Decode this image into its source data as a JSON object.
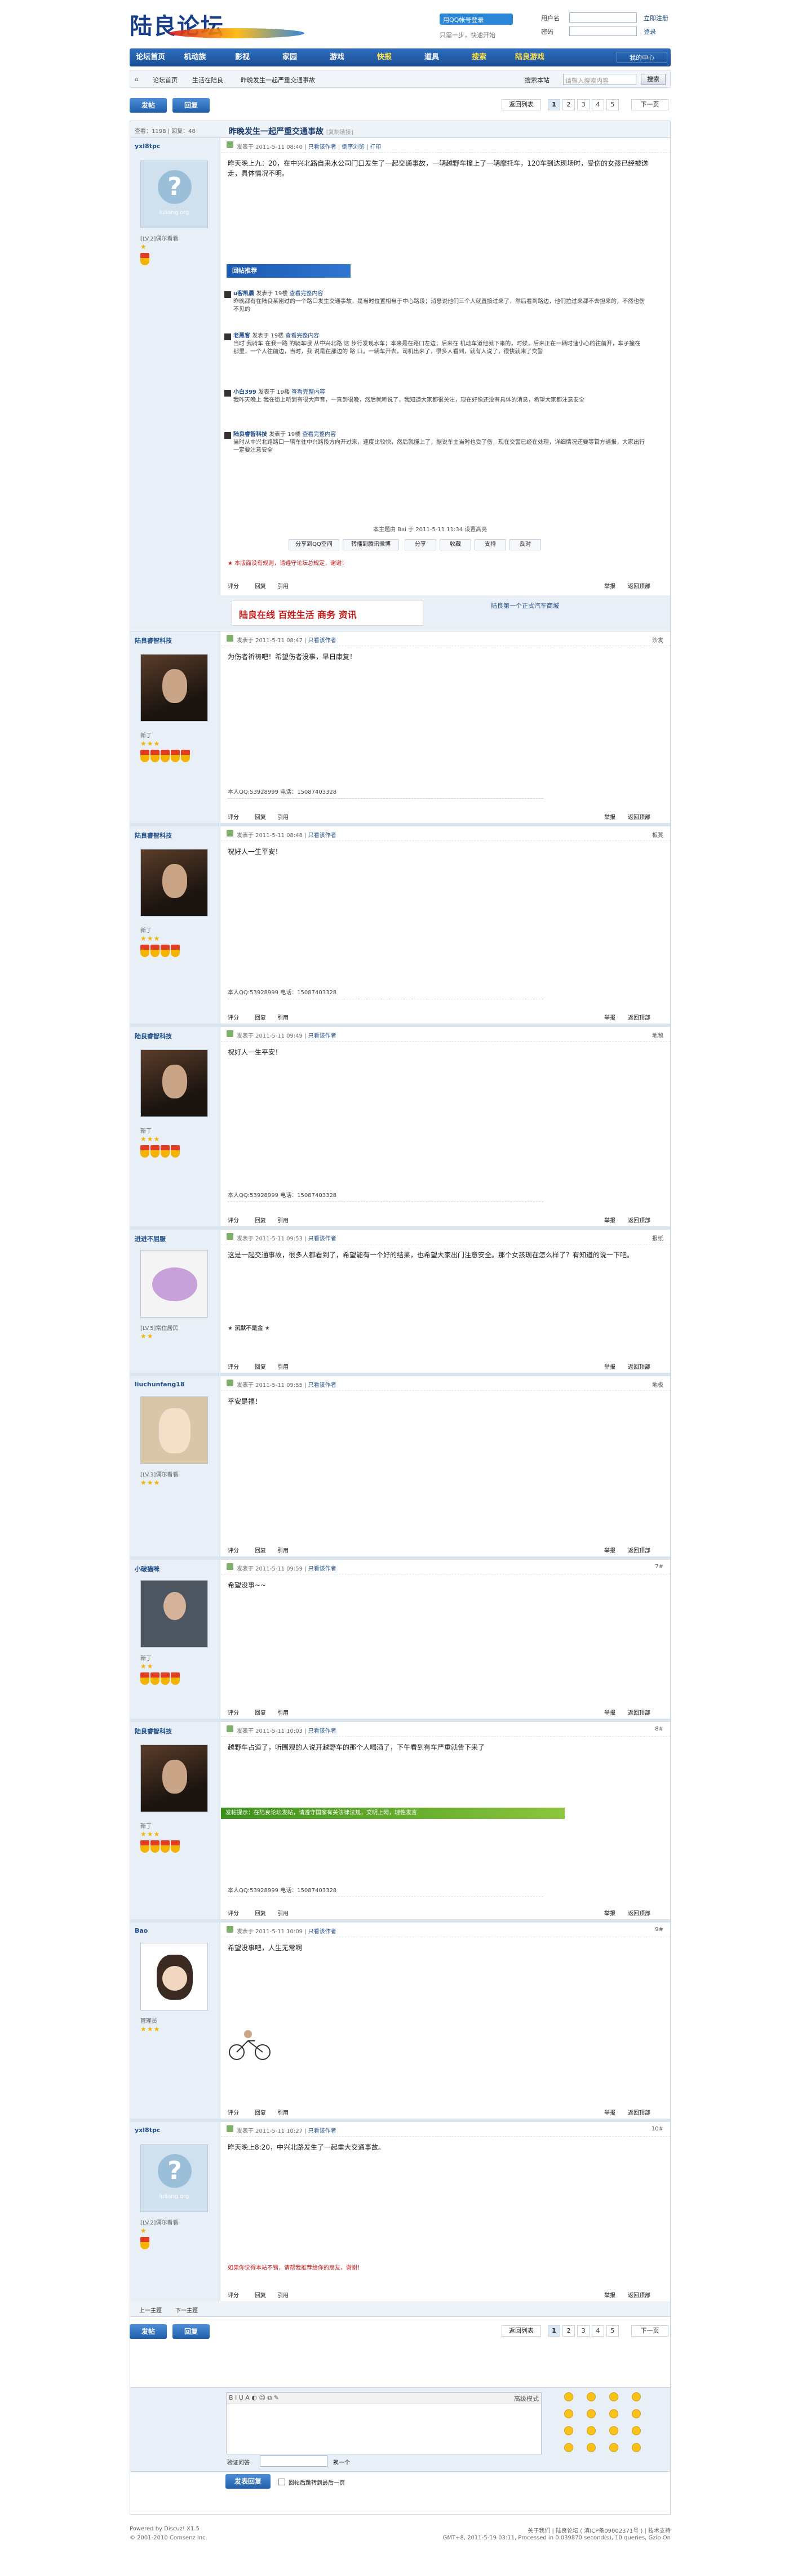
{
  "header": {
    "logo_text": "陆良论坛",
    "qq_login": "用QQ帐号登录",
    "qq_sub": "只需一步，快速开始",
    "username_label": "用户名",
    "password_label": "密码",
    "autologin": "自动登录",
    "register": "立即注册",
    "forgot": "找回密码",
    "login": "登录"
  },
  "nav": {
    "items": [
      "论坛首页",
      "机动族",
      "影视",
      "家园",
      "游戏",
      "快报",
      "道具",
      "搜索",
      "陆良游戏"
    ],
    "my_center": "我的中心"
  },
  "breadcrumb": {
    "items": [
      "论坛首页",
      "生活在陆良",
      "昨晚发生一起严重交通事故"
    ],
    "search_label": "搜索本站",
    "search_placeholder": "请输入搜索内容",
    "search_button": "搜索"
  },
  "actions": {
    "post": "发帖",
    "reply": "回复",
    "pager": {
      "prev": "返回列表",
      "pages": [
        "1",
        "2",
        "3",
        "4",
        "5"
      ],
      "next": "下一页"
    }
  },
  "thread": {
    "stats": "查看：1198 | 回复：48",
    "title": "昨晚发生一起严重交通事故",
    "title_extra": "[复制链接]",
    "rate_header": "回帖推荐",
    "comments": [
      {
        "user": "u客凯晨",
        "time": "发表于 19楼",
        "link": "查看完整内容",
        "text": "昨晚都有在陆良某刚过的一个路口发生交通事故，是当时位置相当于中心路段；消息说他们三个人就直接过来了，然后看到路边，他们拉过来都不去担来的，不然也伤不见的"
      },
      {
        "user": "老黑客",
        "time": "发表于 19楼",
        "link": "查看完整内容",
        "text": "当时 我骑车 在我一路 的骑车哦 从中兴北路 这 步行发现水车；本来是在路口左边；后来在 机动车道他就下来的，时候，后来正在一辆时速小心的往前开，车子撞在那里，一个人往前边，当时，我 说是在那边的 路 口，一辆车开去，司机出来了，很多人看到，就有人说了，很快就来了交警"
      },
      {
        "user": "小白399",
        "time": "发表于 19楼",
        "link": "查看完整内容",
        "text": "我昨天晚上 我在街上听到有很大声音，一直到很晚，然后就听说了，我知道大家都很关注，现在好像还没有具体的消息，希望大家都注意安全"
      },
      {
        "user": "陆良睿智科技",
        "time": "发表于 19楼",
        "link": "查看完整内容",
        "text": "当时从中兴北路路口一辆车往中兴路段方向开过来，速度比较快，然后就撞上了，据说车主当时也受了伤，现在交警已经在处理，详细情况还要等官方通报，大家出行一定要注意安全"
      }
    ],
    "sig_line": "本主题由 Bai 于 2011-5-11 11:34 设置高亮",
    "share": [
      "分享到QQ空间",
      "转播到腾讯微博",
      "分享",
      "收藏",
      "支持",
      "反对"
    ],
    "red_note": "★ 本版面没有规则，请遵守论坛总规定，谢谢！"
  },
  "posts": [
    {
      "user": "yxl8tpc",
      "floor": "楼主",
      "time": "发表于 2011-5-11 08:40",
      "only": "只看该作者",
      "extra": "倒序浏览 | 打印",
      "body": "昨天晚上九：20，在中兴北路自来水公司门口发生了一起交通事故，一辆越野车撞上了一辆摩托车，120车到达现场时，受伤的女孩已经被送走，具体情况不明。",
      "level": "[LV.2]偶尔看看",
      "avatar": "qm"
    },
    {
      "user": "陆良睿智科技",
      "floor": "沙发",
      "time": "发表于 2011-5-11 08:47",
      "only": "只看该作者",
      "body": "为伤者祈祷吧！希望伤者没事，早日康复！",
      "level": "新丁",
      "qq": "本人QQ:53928999  电话：15087403328",
      "avatar": "dark"
    },
    {
      "user": "陆良睿智科技",
      "floor": "板凳",
      "time": "发表于 2011-5-11 08:48",
      "only": "只看该作者",
      "body": "祝好人一生平安！",
      "level": "新丁",
      "qq": "本人QQ:53928999  电话：15087403328",
      "avatar": "dark"
    },
    {
      "user": "陆良睿智科技",
      "floor": "地毯",
      "time": "发表于 2011-5-11 09:49",
      "only": "只看该作者",
      "body": "祝好人一生平安！",
      "level": "新丁",
      "qq": "本人QQ:53928999  电话：15087403328",
      "avatar": "dark"
    },
    {
      "user": "进进不屈服",
      "floor": "报纸",
      "time": "发表于 2011-5-11 09:53",
      "only": "只看该作者",
      "body": "这是一起交通事故，很多人都看到了，希望能有一个好的结果，也希望大家出门注意安全。那个女孩现在怎么样了？有知道的说一下吧。",
      "level": "[LV.5]常住居民",
      "extra_line": "★ 沉默不是金 ★",
      "avatar": "pig"
    },
    {
      "user": "liuchunfang18",
      "floor": "地板",
      "time": "发表于 2011-5-11 09:55",
      "only": "只看该作者",
      "body": "平安是福！",
      "level": "[LV.3]偶尔看看",
      "avatar": "doll"
    },
    {
      "user": "小破猫咪",
      "floor": "7#",
      "time": "发表于 2011-5-11 09:59",
      "only": "只看该作者",
      "body": "希望没事~~",
      "level": "新丁",
      "avatar": "girl"
    },
    {
      "user": "陆良睿智科技",
      "floor": "8#",
      "time": "发表于 2011-5-11 10:03",
      "only": "只看该作者",
      "body": "越野车占道了，听围观的人说开越野车的那个人喝酒了，下午看到有车严重就告下来了",
      "level": "新丁",
      "qq": "本人QQ:53928999  电话：15087403328",
      "green": "发帖提示：在陆良论坛发帖，请遵守国家有关法律法规，文明上网，理性发言",
      "avatar": "dark"
    },
    {
      "user": "Bao",
      "floor": "9#",
      "time": "发表于 2011-5-11 10:09",
      "only": "只看该作者",
      "body": "希望没事吧，人生无常啊",
      "level": "管理员",
      "avatar": "cartoon"
    },
    {
      "user": "yxl8tpc",
      "floor": "10#",
      "time": "发表于 2011-5-11 10:27",
      "only": "只看该作者",
      "body": "昨天晚上8:20，中兴北路发生了一起重大交通事故。",
      "level": "[LV.2]偶尔看看",
      "red": "如果你觉得本站不错，请帮我推荐给你的朋友，谢谢！",
      "avatar": "qm"
    }
  ],
  "post_foot": {
    "rate": "评分",
    "reply": "回复",
    "quote": "引用",
    "report": "举报",
    "top": "返回顶部"
  },
  "bottom_nav": {
    "prev": "上一主题",
    "next": "下一主题"
  },
  "reply_box": {
    "toolbar": "B  I  U  A  ◐  ☺  ⧉  ✎",
    "advanced": "高级模式",
    "verify_label": "验证问答",
    "verify_hint": "换一个",
    "submit": "发表回复",
    "checkbox": "回帖后跳转到最后一页"
  },
  "footer": {
    "powered": "Powered by Discuz! X1.5",
    "copyright": "© 2001-2010 Comsenz Inc.",
    "right1": "关于我们 | 陆良论坛 ( 滇ICP备09002371号 ) | 技术支持",
    "right2": "GMT+8, 2011-5-19 03:11, Processed in 0.039870 second(s), 10 queries, Gzip On"
  },
  "ad": {
    "left": "陆良在线  百姓生活 商务 资讯",
    "right": "陆良第一个正式汽车商城"
  }
}
